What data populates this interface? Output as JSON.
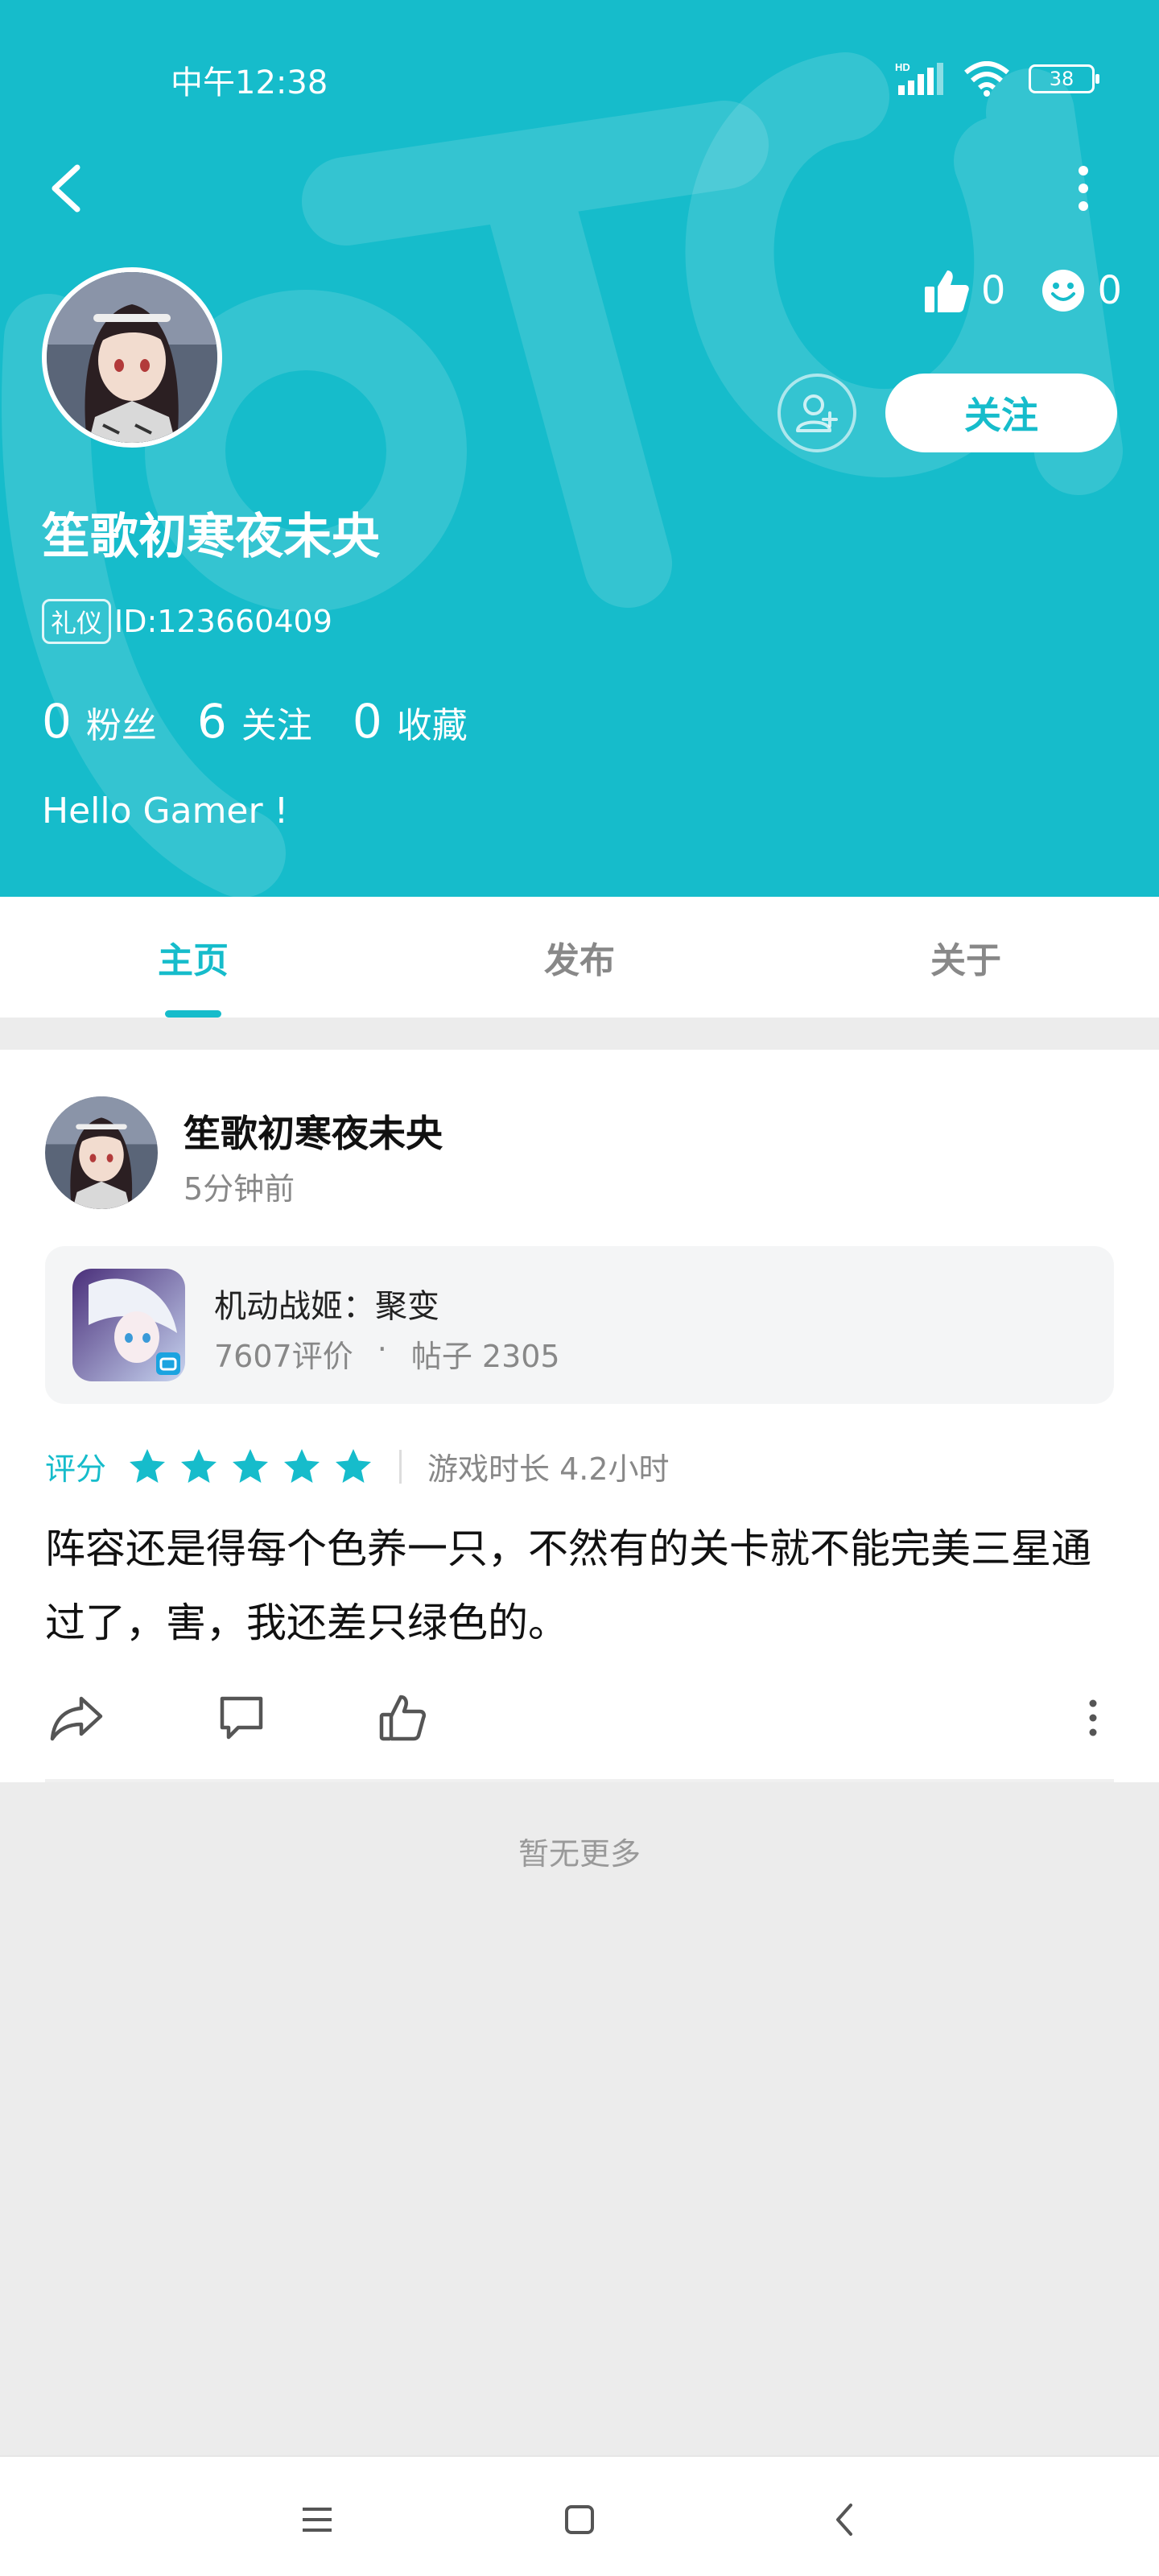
{
  "status_bar": {
    "time": "中午12:38",
    "battery": "38",
    "network": "HD"
  },
  "header": {
    "likes_count": "0",
    "smiles_count": "0",
    "follow_label": "关注",
    "username": "笙歌初寒夜未央",
    "badge": "礼仪",
    "id_text": "ID:123660409",
    "stats": [
      {
        "num": "0",
        "label": "粉丝"
      },
      {
        "num": "6",
        "label": "关注"
      },
      {
        "num": "0",
        "label": "收藏"
      }
    ],
    "bio": "Hello Gamer !",
    "bg_color": "#16bccb"
  },
  "tabs": [
    {
      "label": "主页",
      "active": true
    },
    {
      "label": "发布",
      "active": false
    },
    {
      "label": "关于",
      "active": false
    }
  ],
  "post": {
    "author": "笙歌初寒夜未央",
    "time": "5分钟前",
    "game": {
      "name": "机动战姬：聚变",
      "reviews": "7607评价",
      "dot": "·",
      "posts": "帖子 2305"
    },
    "rating_label": "评分",
    "stars": 5,
    "playtime": "游戏时长 4.2小时",
    "content": "阵容还是得每个色养一只，不然有的关卡就不能完美三星通过了，害，我还差只绿色的。"
  },
  "no_more": "暂无更多",
  "icons": {
    "back": "back-arrow-icon",
    "more": "more-vertical-icon",
    "like": "thumbs-up-icon",
    "smile": "smile-icon",
    "add_friend": "add-friend-icon",
    "share": "share-icon",
    "comment": "comment-icon",
    "star": "star-icon",
    "menu": "menu-icon",
    "home": "home-icon",
    "nav_back": "nav-back-icon"
  },
  "colors": {
    "accent": "#16bccb",
    "star": "#16bccb"
  }
}
